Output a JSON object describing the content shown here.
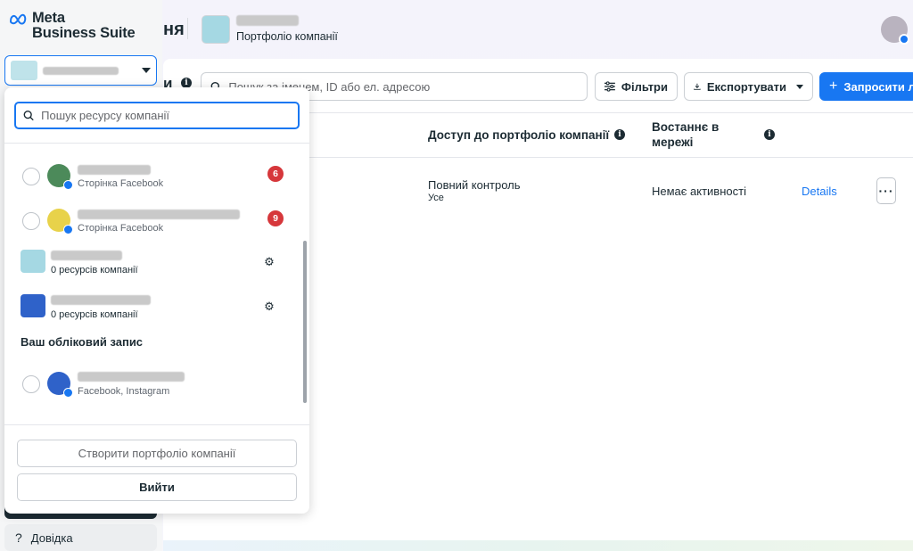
{
  "brand": {
    "line1": "Meta",
    "line2": "Business Suite",
    "accent": "#1877f2"
  },
  "account_selector": {
    "caret_icon": "triangle-down-icon"
  },
  "nav": {
    "help_label": "Довідка",
    "help_icon": "question-icon"
  },
  "header": {
    "partial_title": "ня",
    "business_subtitle": "Портфоліо компанії"
  },
  "toolbar": {
    "title_tail": "и",
    "search_placeholder": "Пошук за іменем, ID або ел. адресою",
    "filters_label": "Фільтри",
    "export_label": "Експортувати",
    "invite_label": "Запросити л"
  },
  "table": {
    "columns": {
      "access": "Доступ до портфоліо компанії",
      "last_online": "Востаннє в мережі"
    },
    "rows": [
      {
        "access": "Повний контроль",
        "access_sub": "Усе",
        "activity": "Немає активності",
        "details": "Details",
        "more": "···"
      }
    ]
  },
  "dropdown": {
    "search_placeholder": "Пошук ресурсу компанії",
    "items": [
      {
        "sub": "Сторінка Facebook",
        "count": "6"
      },
      {
        "sub": "Сторінка Facebook",
        "count": "9"
      },
      {
        "sub": "0 ресурсів компанії"
      },
      {
        "sub": "0 ресурсів компанії"
      }
    ],
    "section_account": "Ваш обліковий запис",
    "account_item": {
      "sub": "Facebook, Instagram"
    },
    "create_label": "Створити портфоліо компанії",
    "logout_label": "Вийти"
  }
}
